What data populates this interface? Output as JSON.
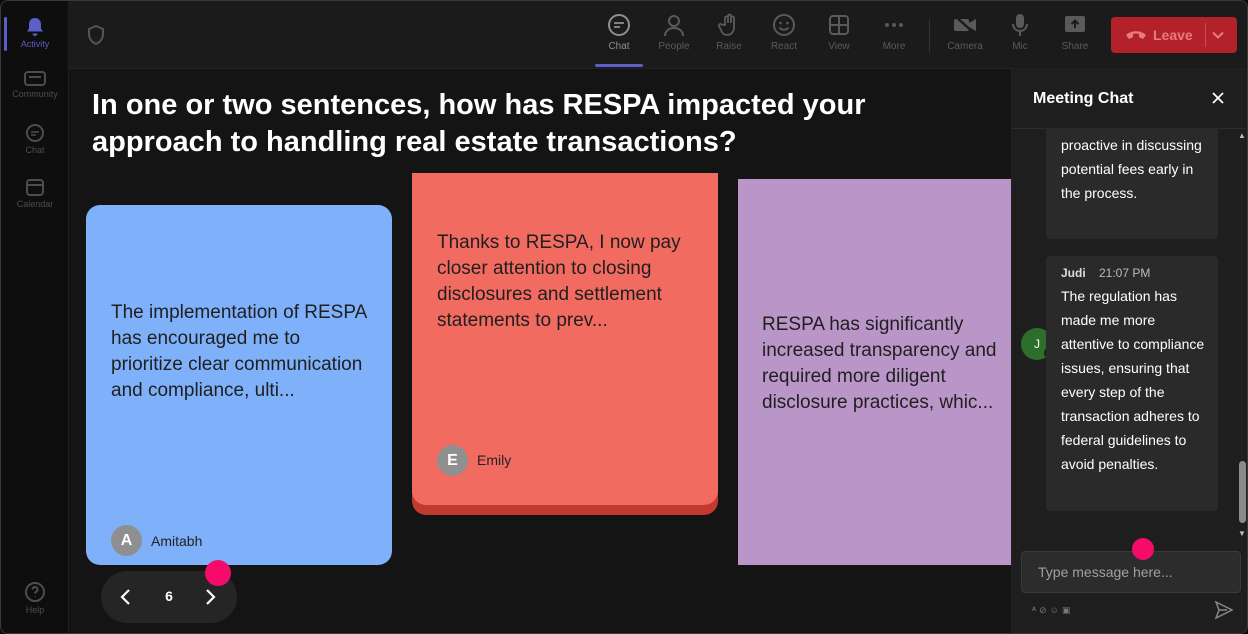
{
  "rail": {
    "items": [
      {
        "label": "Activity",
        "icon": "bell-icon",
        "active": true
      },
      {
        "label": "Community",
        "icon": "community-icon"
      },
      {
        "label": "Chat",
        "icon": "chat-icon"
      },
      {
        "label": "Calendar",
        "icon": "calendar-icon"
      }
    ],
    "help": "Help"
  },
  "toolbar": {
    "chat": "Chat",
    "people": "People",
    "raise": "Raise",
    "react": "React",
    "view": "View",
    "more": "More",
    "camera": "Camera",
    "mic": "Mic",
    "share": "Share",
    "leave": "Leave"
  },
  "question": "In one or two sentences, how has RESPA impacted your approach to handling real estate transactions?",
  "cards": [
    {
      "text": "The implementation of RESPA has encouraged me to prioritize clear communication and compliance, ulti...",
      "author": "Amitabh",
      "initial": "A",
      "color": "#7fb0fa"
    },
    {
      "text": "Thanks to RESPA, I now pay closer attention to closing disclosures and settlement statements to prev...",
      "author": "Emily",
      "initial": "E",
      "color": "#f26b61"
    },
    {
      "text": "RESPA has significantly increased transparency and required more diligent disclosure practices, whic...",
      "color": "#ba96c8"
    }
  ],
  "pager": {
    "page": "6"
  },
  "chat": {
    "title": "Meeting Chat",
    "messages": [
      {
        "body": "proactive in discussing potential fees early in the process."
      },
      {
        "author": "Judi",
        "initial": "J",
        "time": "21:07 PM",
        "body": "The regulation has made me more attentive to compliance issues, ensuring that every step of the transaction adheres to federal guidelines to avoid penalties."
      }
    ],
    "placeholder": "Type message here..."
  },
  "colors": {
    "accent": "#5b5fc7",
    "leave": "#b3222b",
    "cursor_dot": "#f50c6a"
  }
}
